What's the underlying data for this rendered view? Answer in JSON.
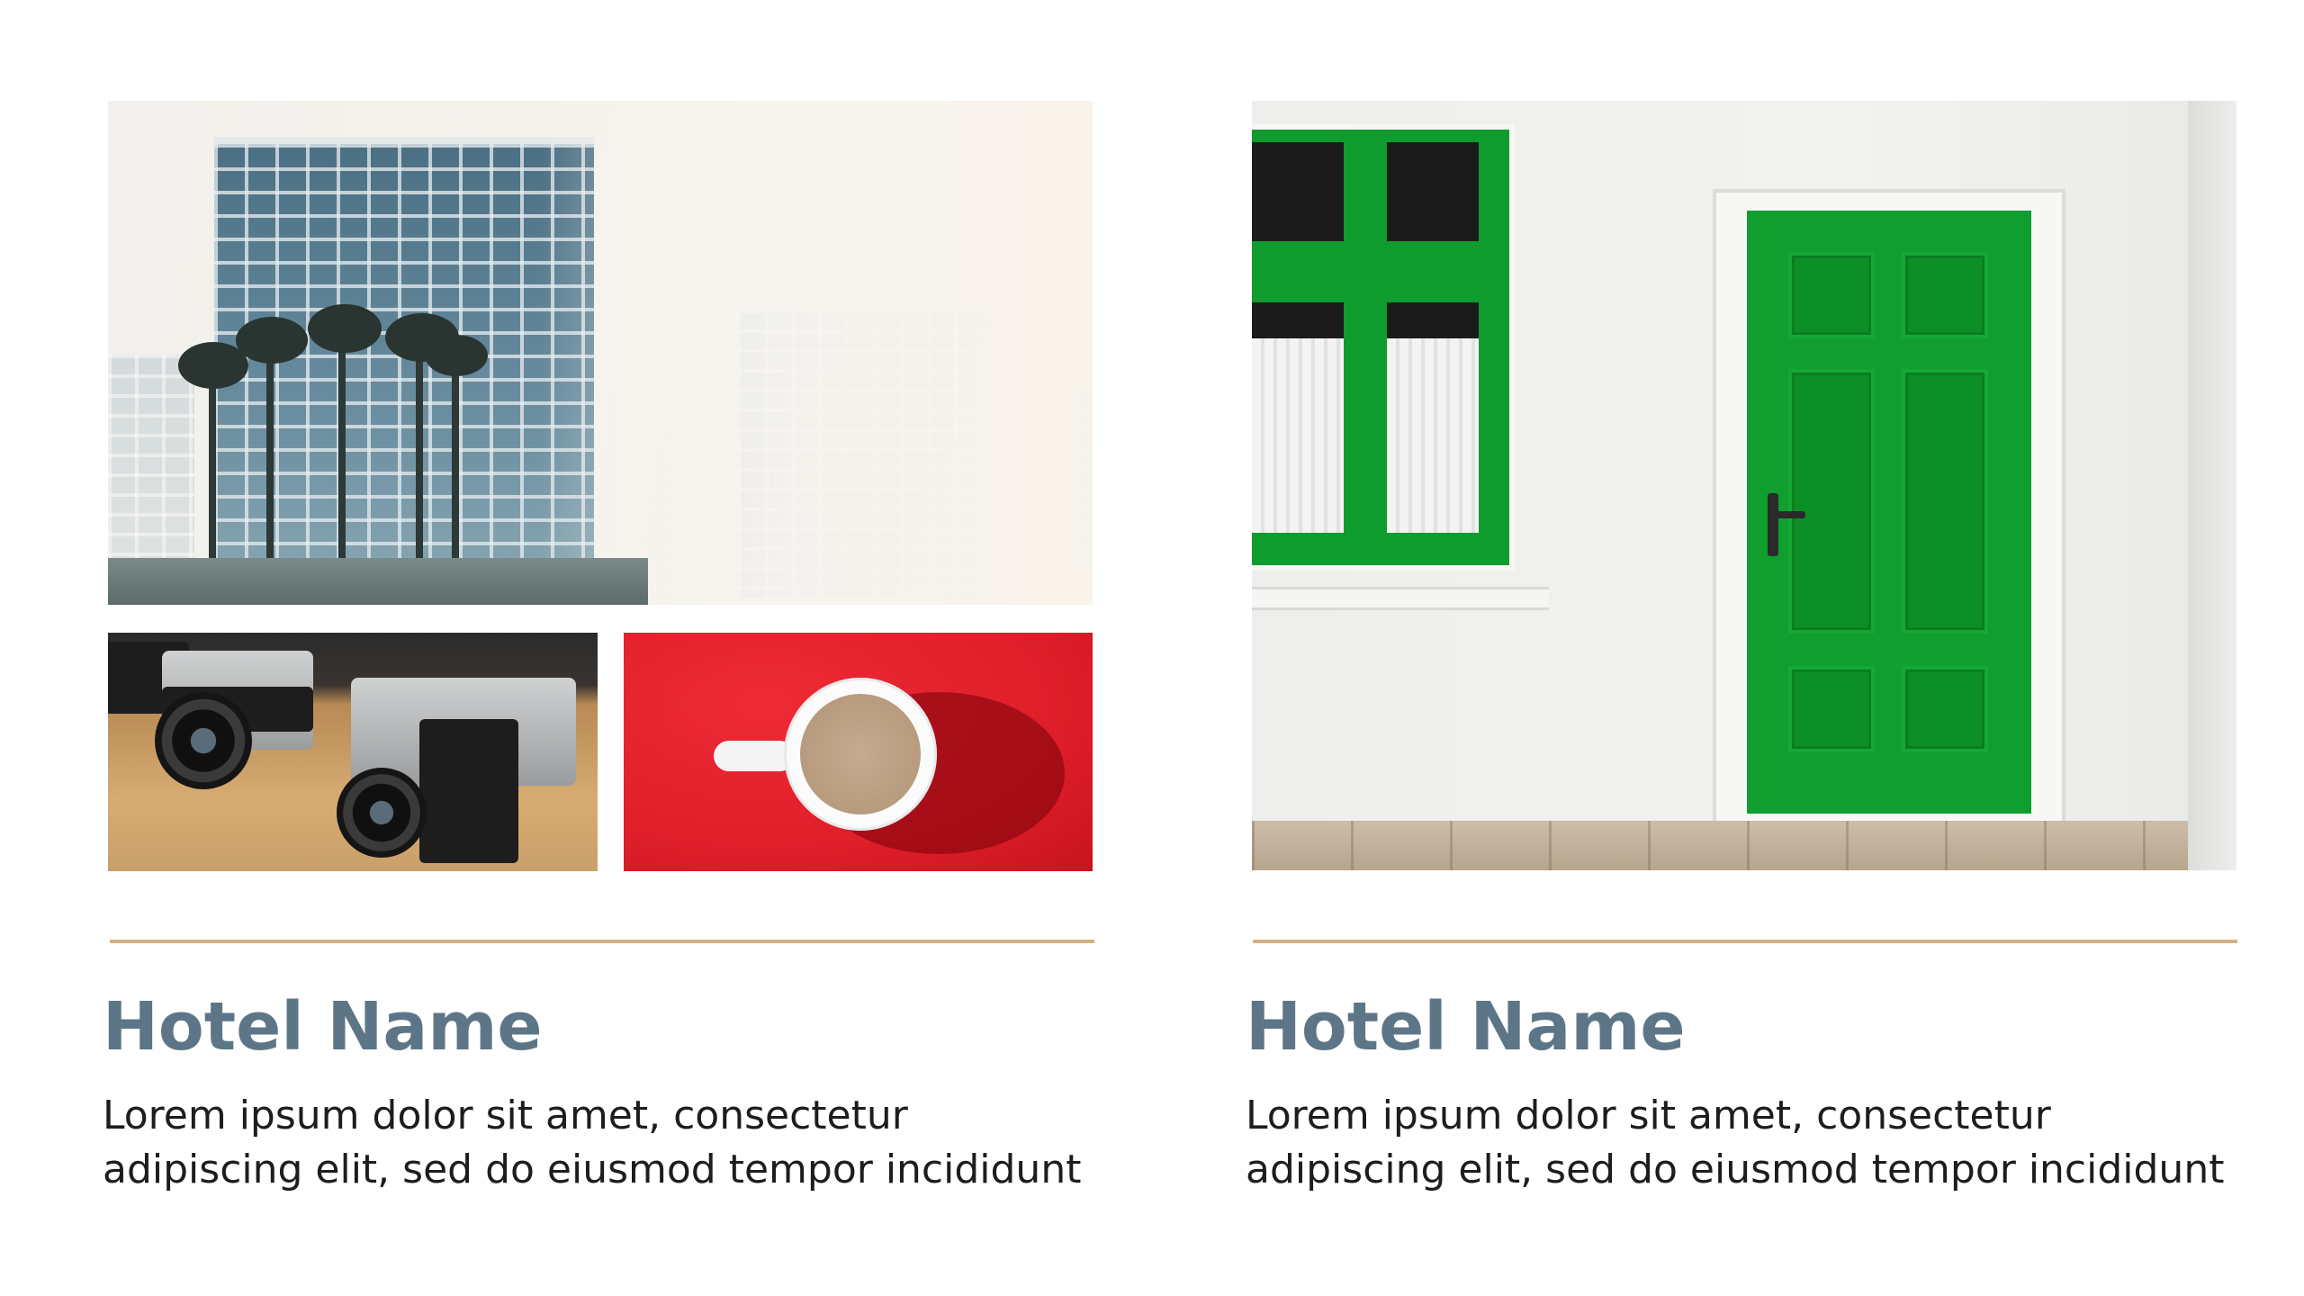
{
  "left_card": {
    "title": "Hotel Name",
    "description": "Lorem ipsum dolor sit amet, consectetur adipiscing elit, sed do eiusmod tempor incididunt",
    "photos": [
      "city-hotel-towers-photo",
      "vintage-cameras-photo",
      "coffee-cup-photo"
    ]
  },
  "right_card": {
    "title": "Hotel Name",
    "description": "Lorem ipsum dolor sit amet, consectetur adipiscing elit, sed do eiusmod tempor incididunt",
    "photos": [
      "green-door-photo"
    ]
  },
  "colors": {
    "title": "#5d7687",
    "divider": "#d4b183",
    "body_text": "#1d1d1d",
    "background": "#ffffff"
  }
}
